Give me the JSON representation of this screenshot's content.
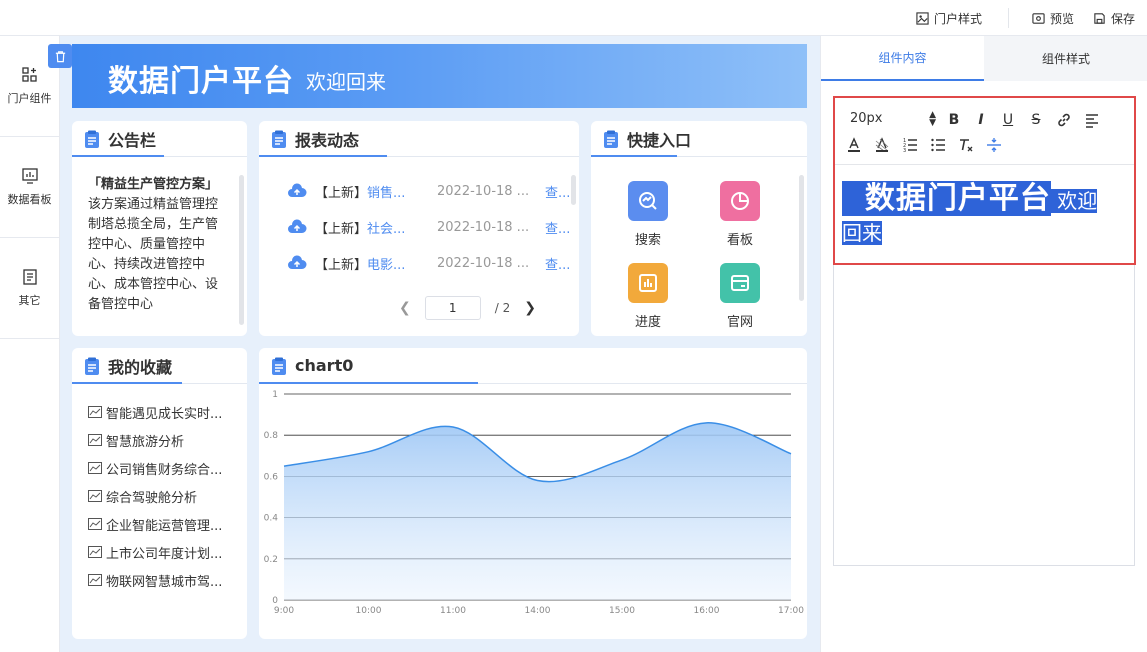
{
  "topbar": {
    "portal_style": "门户样式",
    "preview": "预览",
    "save": "保存"
  },
  "rail": {
    "items": [
      {
        "label": "门户组件",
        "icon": "grid-plus-icon"
      },
      {
        "label": "数据看板",
        "icon": "chart-board-icon"
      },
      {
        "label": "其它",
        "icon": "document-icon"
      }
    ]
  },
  "banner": {
    "title": "数据门户平台",
    "subtitle": "欢迎回来"
  },
  "notice": {
    "title": "公告栏",
    "item_title": "「精益生产管控方案」",
    "item_body": "该方案通过精益管理控制塔总揽全局，生产管控中心、质量管控中心、持续改进管控中心、成本管控中心、设备管控中心"
  },
  "reports": {
    "title": "报表动态",
    "rows": [
      {
        "tag": "【上新】",
        "name": "销售...",
        "date": "2022-10-18 ...",
        "link": "查..."
      },
      {
        "tag": "【上新】",
        "name": "社会...",
        "date": "2022-10-18 ...",
        "link": "查..."
      },
      {
        "tag": "【上新】",
        "name": "电影...",
        "date": "2022-10-18 ...",
        "link": "查..."
      }
    ],
    "pager": {
      "current": "1",
      "total": "/ 2"
    }
  },
  "quick": {
    "title": "快捷入口",
    "items": [
      {
        "label": "搜索",
        "color": "#5b8def"
      },
      {
        "label": "看板",
        "color": "#ef6fa0"
      },
      {
        "label": "进度",
        "color": "#f2a93b"
      },
      {
        "label": "官网",
        "color": "#43c2a9"
      }
    ]
  },
  "favorites": {
    "title": "我的收藏",
    "items": [
      "智能遇见成长实时...",
      "智慧旅游分析",
      "公司销售财务综合...",
      "综合驾驶舱分析",
      "企业智能运营管理...",
      "上市公司年度计划...",
      "物联网智慧城市驾..."
    ]
  },
  "chart_data": {
    "type": "area",
    "title": "chart0",
    "x": [
      "9:00",
      "10:00",
      "11:00",
      "14:00",
      "15:00",
      "16:00",
      "17:00"
    ],
    "series": [
      {
        "values": [
          0.65,
          0.72,
          0.84,
          0.58,
          0.68,
          0.86,
          0.71
        ]
      }
    ],
    "ylim": [
      0,
      1
    ],
    "yticks": [
      "0",
      "0.2",
      "0.4",
      "0.6",
      "0.8",
      "1"
    ],
    "grid": true,
    "color": "#3a8ee6"
  },
  "right_panel": {
    "tabs": [
      "组件内容",
      "组件样式"
    ],
    "font_size": "20px",
    "content_big": "数据门户平台",
    "content_small": "欢迎回来"
  },
  "colors": {
    "accent": "#4f8cf0",
    "highlight": "#2e63d8",
    "focus_border": "#e04848"
  }
}
